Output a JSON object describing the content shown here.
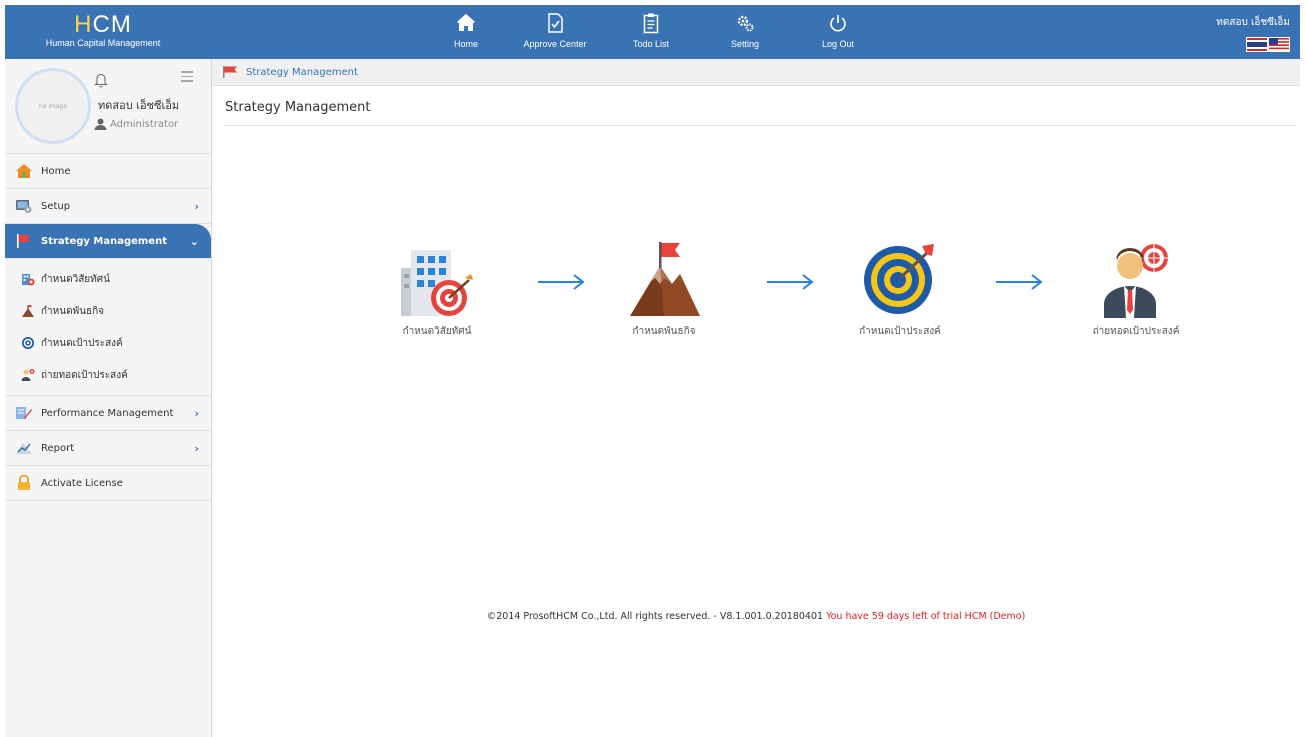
{
  "app": {
    "logo_text": "HCM",
    "logo_subtitle": "Human Capital Management"
  },
  "nav": [
    {
      "label": "Home",
      "icon": "home-icon"
    },
    {
      "label": "Approve Center",
      "icon": "approve-document-icon"
    },
    {
      "label": "Todo List",
      "icon": "clipboard-icon"
    },
    {
      "label": "Setting",
      "icon": "gears-icon"
    },
    {
      "label": "Log Out",
      "icon": "power-icon"
    }
  ],
  "user": {
    "name": "ทดสอบ เอ็ชซีเอ็ม",
    "role": "Administrator",
    "avatar_text": "no image"
  },
  "sidebar": {
    "items": [
      {
        "label": "Home",
        "icon": "home-icon"
      },
      {
        "label": "Setup",
        "icon": "setup-icon"
      },
      {
        "label": "Strategy Management",
        "icon": "flag-icon"
      },
      {
        "label": "Performance Management",
        "icon": "performance-icon"
      },
      {
        "label": "Report",
        "icon": "report-chart-icon"
      },
      {
        "label": "Activate License",
        "icon": "lock-icon"
      }
    ],
    "sub_items": [
      {
        "label": "กำหนดวิสัยทัศน์",
        "icon": "building-icon"
      },
      {
        "label": "กำหนดพันธกิจ",
        "icon": "mountain-icon"
      },
      {
        "label": "กำหนดเป้าประสงค์",
        "icon": "target-icon"
      },
      {
        "label": "ถ่ายทอดเป้าประสงค์",
        "icon": "person-target-icon"
      }
    ]
  },
  "breadcrumb": "Strategy Management",
  "page_title": "Strategy Management",
  "steps": [
    {
      "label": "กำหนดวิสัยทัศน์",
      "icon": "building-target-icon"
    },
    {
      "label": "กำหนดพันธกิจ",
      "icon": "mountain-flag-icon"
    },
    {
      "label": "กำหนดเป้าประสงค์",
      "icon": "target-icon"
    },
    {
      "label": "ถ่ายทอดเป้าประสงค์",
      "icon": "businessman-target-icon"
    }
  ],
  "footer": {
    "copyright": "©2014 ProsoftHCM Co.,Ltd. All rights reserved. - V8.1.001.0.20180401",
    "trial": "You have 59 days left of trial HCM (Demo)"
  },
  "colors": {
    "primary": "#3a73b4",
    "accent_red": "#e02020"
  }
}
